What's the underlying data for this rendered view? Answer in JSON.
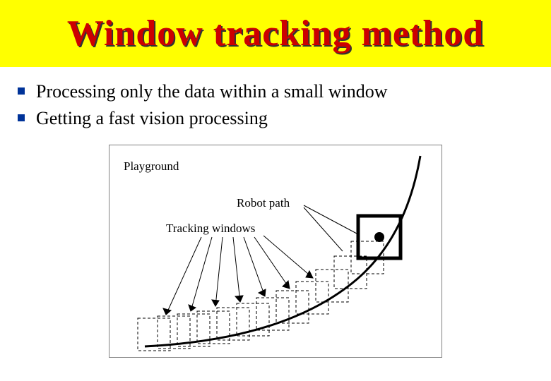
{
  "title": "Window tracking method",
  "bullets": [
    "Processing only the data within a small window",
    "Getting a fast vision processing"
  ],
  "diagram": {
    "label_playground": "Playground",
    "label_robot_path": "Robot path",
    "label_tracking_windows": "Tracking windows"
  }
}
